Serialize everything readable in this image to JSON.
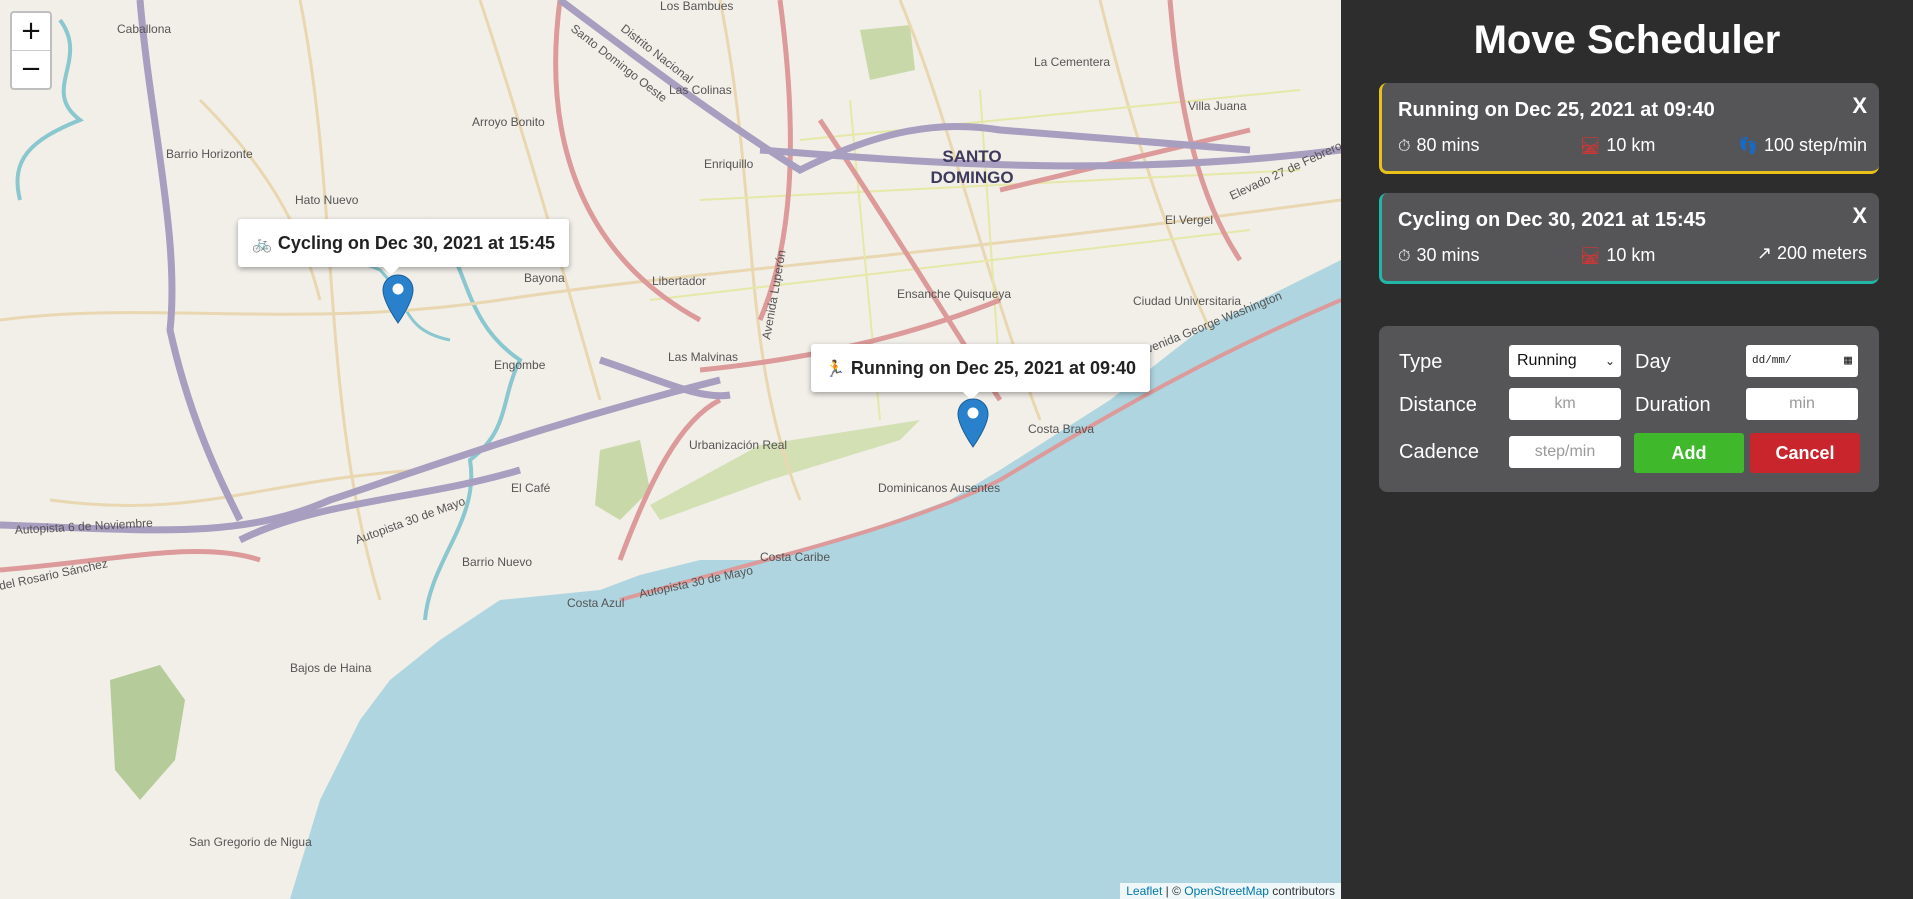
{
  "map": {
    "zoom_in": "+",
    "zoom_out": "−",
    "place_labels": {
      "santo_domingo_1": "SANTO",
      "santo_domingo_2": "DOMINGO",
      "caballona": "Caballona",
      "los_bambues": "Los Bambues",
      "la_cementera": "La Cementera",
      "villa_juana": "Villa Juana",
      "los_colinas": "Las Colinas",
      "barrio_horizonte": "Barrio Horizonte",
      "arroyo_bonito": "Arroyo Bonito",
      "hato_nuevo": "Hato Nuevo",
      "enriquillo": "Enriquillo",
      "bayona": "Bayona",
      "libertador": "Libertador",
      "engombe": "Engombe",
      "las_malvinas": "Las Malvinas",
      "ensanche_quisqueya": "Ensanche Quisqueya",
      "ciudad_universitaria": "Ciudad Universitaria",
      "el_vergel": "El Vergel",
      "urbanizacion_real": "Urbanización Real",
      "costa_brava": "Costa Brava",
      "dominicanos_ausentes": "Dominicanos Ausentes",
      "el_cafe": "El Café",
      "barrio_nuevo": "Barrio Nuevo",
      "costa_caribe": "Costa Caribe",
      "costa_azul": "Costa Azul",
      "bajos_de_haina": "Bajos de Haina",
      "san_gregorio": "San Gregorio de Nigua",
      "autopista_6_nov": "Autopista 6 de Noviembre",
      "autopista_30_mayo": "Autopista 30 de Mayo",
      "avenida_gw": "Avenida George Washington",
      "elevado": "Elevado 27 de Febrero",
      "santo_domingo_oeste": "Santo Domingo Oeste",
      "distrito_nacional": "Distrito Nacional",
      "del_rosario": "del Rosario Sánchez",
      "avenida_luperon": "Avenida Luperón"
    },
    "popups": [
      {
        "icon": "🚲",
        "text": "Cycling on Dec 30, 2021 at 15:45"
      },
      {
        "icon": "🏃",
        "text": "Running on Dec 25, 2021 at 09:40"
      }
    ],
    "attribution": {
      "leaflet": "Leaflet",
      "sep": " | © ",
      "osm": "OpenStreetMap",
      "rest": " contributors"
    }
  },
  "sidebar": {
    "title": "Move Scheduler",
    "workouts": [
      {
        "title": "Running on Dec 25, 2021 at 09:40",
        "close": "X",
        "duration": "80 mins",
        "distance": "10 km",
        "extra": "100 step/min",
        "color": "#e8c21b"
      },
      {
        "title": "Cycling on Dec 30, 2021 at 15:45",
        "close": "X",
        "duration": "30 mins",
        "distance": "10 km",
        "extra": "↗ 200 meters",
        "color": "#22b6a8"
      }
    ],
    "form": {
      "type_label": "Type",
      "type_value": "Running",
      "day_label": "Day",
      "day_placeholder": "dd/mm/",
      "distance_label": "Distance",
      "distance_placeholder": "km",
      "duration_label": "Duration",
      "duration_placeholder": "min",
      "cadence_label": "Cadence",
      "cadence_placeholder": "step/min",
      "add_label": "Add",
      "cancel_label": "Cancel"
    }
  }
}
